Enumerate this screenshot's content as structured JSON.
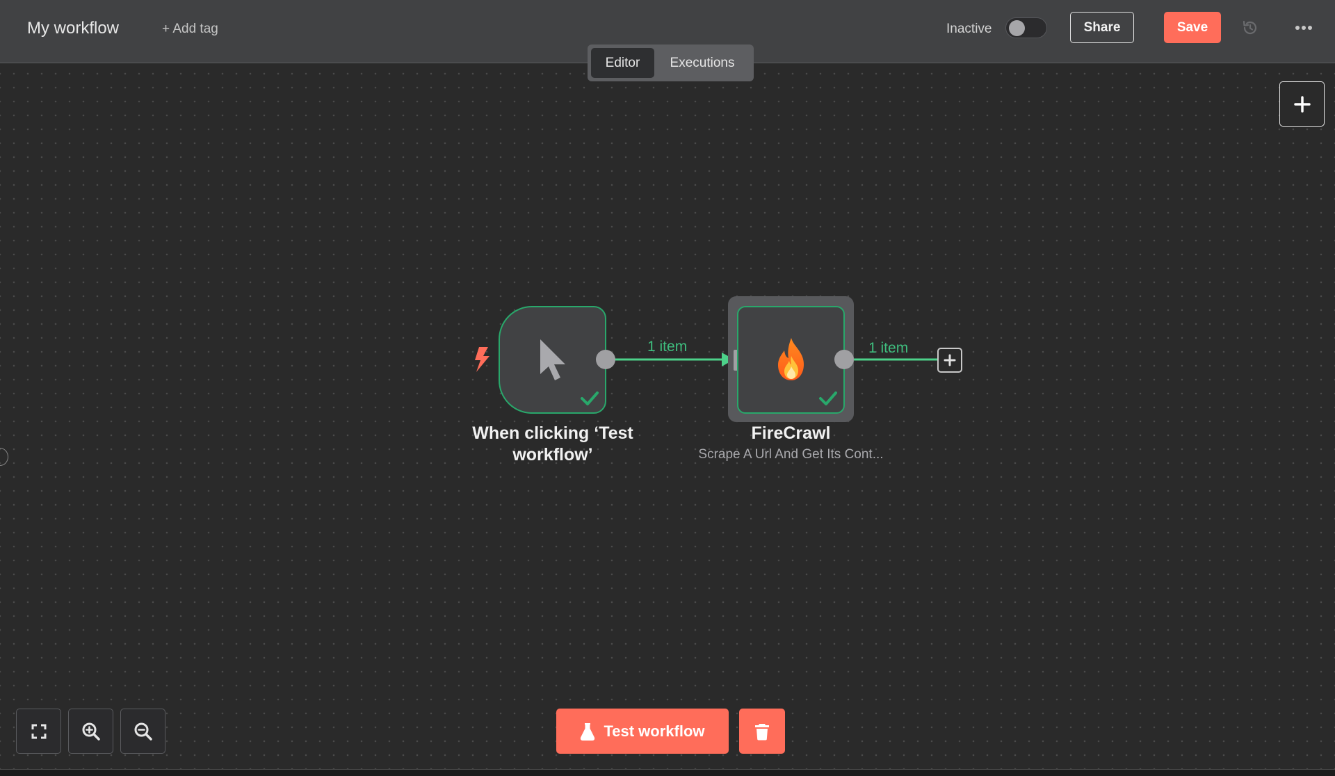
{
  "header": {
    "workflow_title": "My workflow",
    "add_tag_label": "+ Add tag",
    "active_status_label": "Inactive",
    "active_toggle_on": false,
    "share_label": "Share",
    "save_label": "Save",
    "history_icon": "history-icon",
    "more_icon": "more-horizontal-icon"
  },
  "tabs": [
    {
      "label": "Editor",
      "active": true
    },
    {
      "label": "Executions",
      "active": false
    }
  ],
  "canvas": {
    "add_node_icon": "plus-icon",
    "nodes": [
      {
        "title": "When clicking ‘Test workflow’",
        "icon": "mouse-pointer-icon",
        "trigger_icon": "bolt-icon",
        "status_icon": "check-icon"
      },
      {
        "title": "FireCrawl",
        "subtitle": "Scrape A Url And Get Its Cont...",
        "icon": "fire-icon",
        "status_icon": "check-icon"
      }
    ],
    "connections": [
      {
        "label": "1 item"
      },
      {
        "label": "1 item"
      }
    ],
    "end_plus_icon": "plus-icon"
  },
  "controls": {
    "zoom_to_fit_icon": "fullscreen-icon",
    "zoom_in_icon": "zoom-in-icon",
    "zoom_out_icon": "zoom-out-icon",
    "test_workflow_label": "Test workflow",
    "test_icon": "flask-icon",
    "delete_icon": "trash-icon"
  },
  "colors": {
    "accent": "#ff6d5a",
    "success": "#29a86b",
    "connection": "#4dd28a",
    "node_bg": "#414244",
    "canvas_bg": "#2a2a2a"
  }
}
